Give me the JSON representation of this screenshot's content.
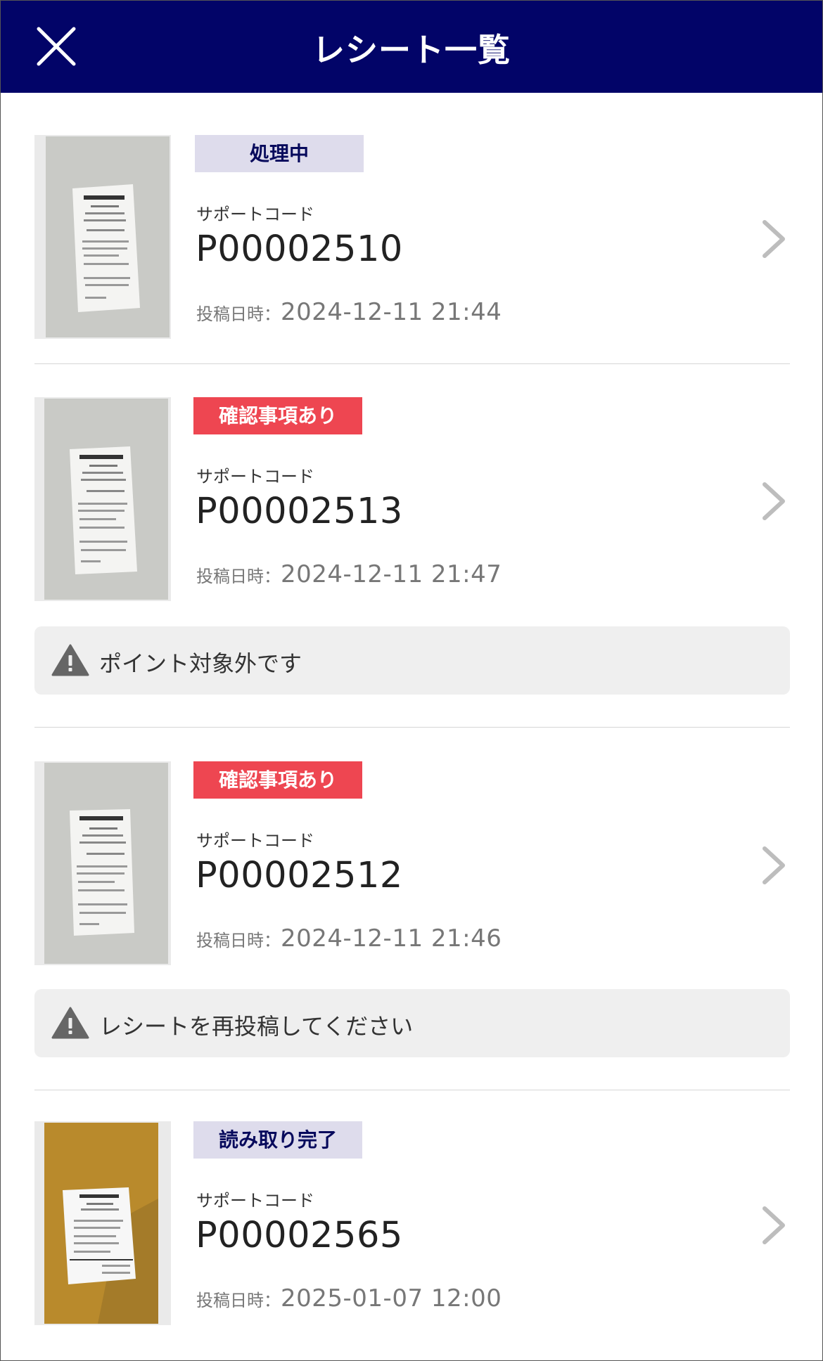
{
  "header": {
    "title": "レシート一覧",
    "close_icon": "close-icon"
  },
  "colors": {
    "header_bg": "#020468",
    "badge_processing_bg": "#dedcec",
    "badge_alert_bg": "#ee4651"
  },
  "receipts": [
    {
      "status": "処理中",
      "status_type": "processing",
      "support_code_label": "サポートコード",
      "support_code": "P00002510",
      "posted_label": "投稿日時：",
      "posted_at": "2024-12-11 21:44",
      "notice": null
    },
    {
      "status": "確認事項あり",
      "status_type": "alert",
      "support_code_label": "サポートコード",
      "support_code": "P00002513",
      "posted_label": "投稿日時：",
      "posted_at": "2024-12-11 21:47",
      "notice": "ポイント対象外です"
    },
    {
      "status": "確認事項あり",
      "status_type": "alert",
      "support_code_label": "サポートコード",
      "support_code": "P00002512",
      "posted_label": "投稿日時：",
      "posted_at": "2024-12-11 21:46",
      "notice": "レシートを再投稿してください"
    },
    {
      "status": "読み取り完了",
      "status_type": "done",
      "support_code_label": "サポートコード",
      "support_code": "P00002565",
      "posted_label": "投稿日時：",
      "posted_at": "2025-01-07 12:00",
      "notice": null
    }
  ]
}
